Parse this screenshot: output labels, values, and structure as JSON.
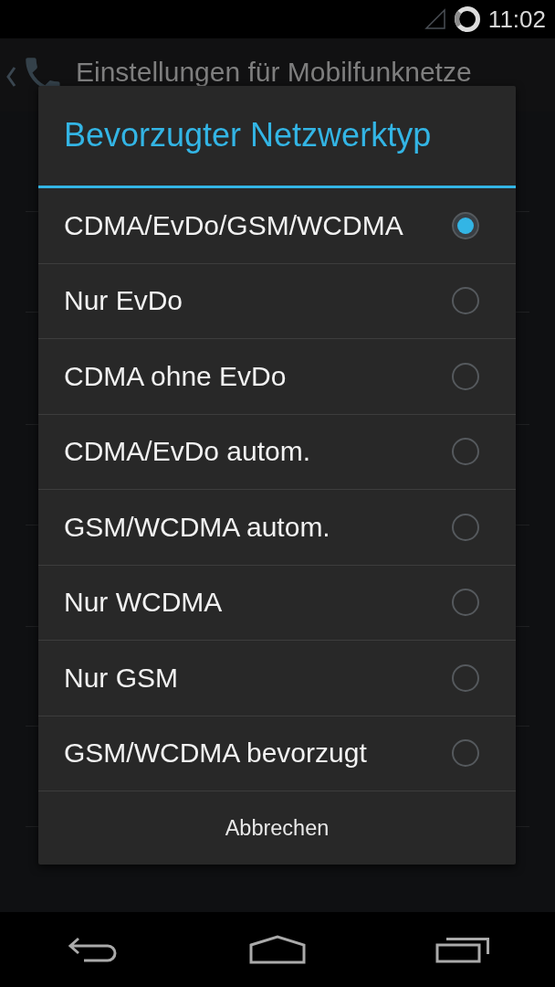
{
  "status_bar": {
    "time": "11:02"
  },
  "action_bar": {
    "title": "Einstellungen für Mobilfunknetze"
  },
  "dialog": {
    "title": "Bevorzugter Netzwerktyp",
    "options": [
      {
        "label": "CDMA/EvDo/GSM/WCDMA",
        "selected": true
      },
      {
        "label": "Nur EvDo",
        "selected": false
      },
      {
        "label": "CDMA ohne EvDo",
        "selected": false
      },
      {
        "label": "CDMA/EvDo autom.",
        "selected": false
      },
      {
        "label": "GSM/WCDMA autom.",
        "selected": false
      },
      {
        "label": "Nur WCDMA",
        "selected": false
      },
      {
        "label": "Nur GSM",
        "selected": false
      },
      {
        "label": "GSM/WCDMA bevorzugt",
        "selected": false
      }
    ],
    "cancel_button": "Abbrechen"
  }
}
